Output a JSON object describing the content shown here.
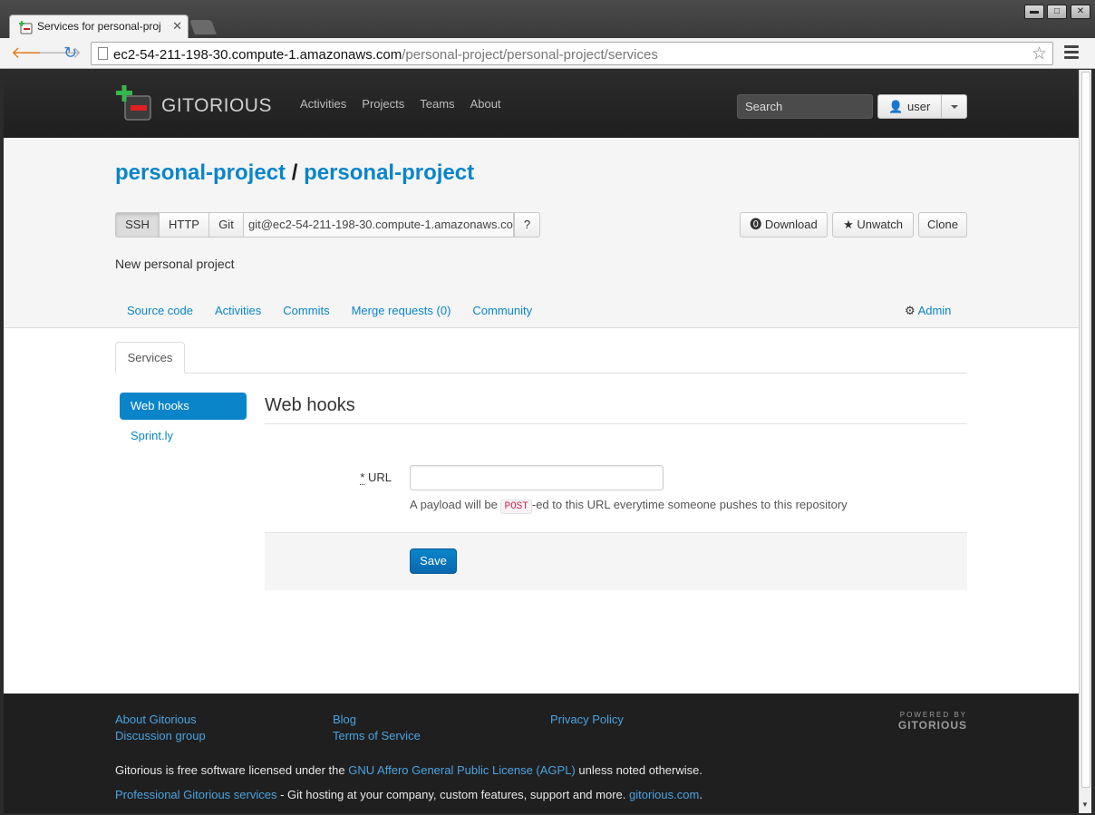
{
  "browser": {
    "tab_title": "Services for personal-proj",
    "url_host": "ec2-54-211-198-30.compute-1.amazonaws.com",
    "url_path": "/personal-project/personal-project/services"
  },
  "header": {
    "logo_text": "GITORIOUS",
    "nav": [
      "Activities",
      "Projects",
      "Teams",
      "About"
    ],
    "search_placeholder": "Search",
    "user_label": "user"
  },
  "project": {
    "owner": "personal-project",
    "separator": "/",
    "name": "personal-project",
    "protocols": [
      "SSH",
      "HTTP",
      "Git"
    ],
    "clone_url": "git@ec2-54-211-198-30.compute-1.amazonaws.co",
    "help_label": "?",
    "actions": {
      "download": "Download",
      "unwatch": "Unwatch",
      "clone": "Clone"
    },
    "description": "New personal project",
    "subnav": [
      "Source code",
      "Activities",
      "Commits",
      "Merge requests (0)",
      "Community"
    ],
    "admin_label": "Admin"
  },
  "services": {
    "tab_label": "Services",
    "side_items": [
      "Web hooks",
      "Sprint.ly"
    ],
    "title": "Web hooks",
    "url_required_mark": "*",
    "url_label": "URL",
    "url_value": "",
    "help_before": "A payload will be",
    "help_code": "POST",
    "help_after": "-ed to this URL everytime someone pushes to this repository",
    "save_label": "Save"
  },
  "footer": {
    "col1": [
      "About Gitorious",
      "Discussion group"
    ],
    "col2": [
      "Blog",
      "Terms of Service"
    ],
    "col3": [
      "Privacy Policy"
    ],
    "powered_by": "POWERED BY",
    "powered_name": "GITORIOUS",
    "license_before": "Gitorious is free software licensed under the",
    "license_link": "GNU Affero General Public License (AGPL)",
    "license_after": "unless noted otherwise.",
    "pro_link": "Professional Gitorious services",
    "pro_text": "- Git hosting at your company, custom features, support and more.",
    "site_link": "gitorious.com",
    "site_after": "."
  },
  "colors": {
    "accent": "#0a85c9",
    "header_bg": "#262626",
    "footer_link": "#4ba3e0"
  }
}
